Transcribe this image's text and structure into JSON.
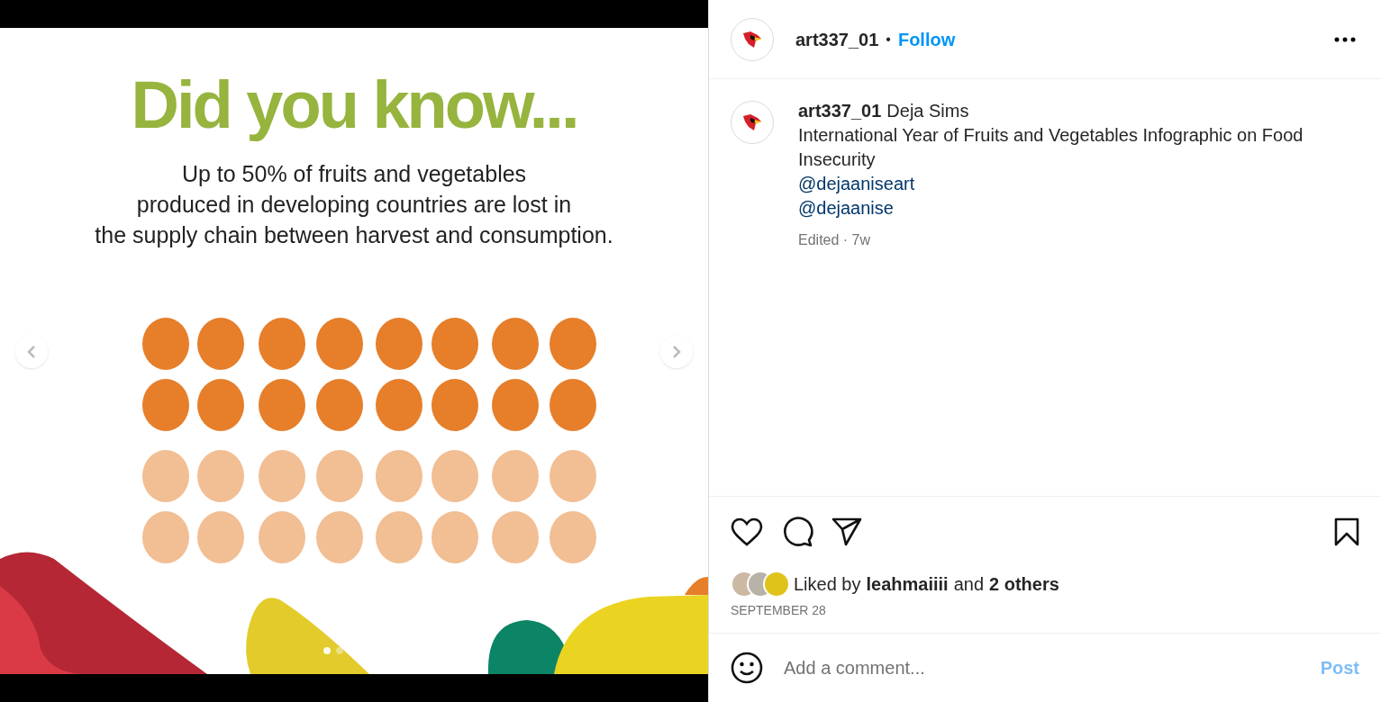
{
  "post": {
    "infographic": {
      "heading": "Did you know...",
      "body": "Up to 50% of fruits and vegetables\nproduced in developing countries are lost in\nthe supply chain between harvest and consumption.",
      "dot_rows": [
        {
          "highlighted": true
        },
        {
          "highlighted": true
        },
        {
          "highlighted": false
        },
        {
          "highlighted": false
        }
      ]
    },
    "carousel_dots": [
      {
        "selected": true
      },
      {
        "selected": false
      }
    ]
  },
  "header": {
    "username": "art337_01",
    "separator": "•",
    "follow": "Follow"
  },
  "caption": {
    "username": "art337_01",
    "author": "Deja Sims",
    "text": "International Year of Fruits and Vegetables Infographic on Food Insecurity",
    "mentions": [
      "@dejaaniseart",
      "@dejaanise"
    ],
    "meta": "Edited · 7w"
  },
  "likes": {
    "prefix": "Liked by",
    "user": "leahmaiiii",
    "joiner": "and",
    "others": "2 others"
  },
  "date": "SEPTEMBER 28",
  "comment": {
    "placeholder": "Add a comment...",
    "post": "Post"
  }
}
